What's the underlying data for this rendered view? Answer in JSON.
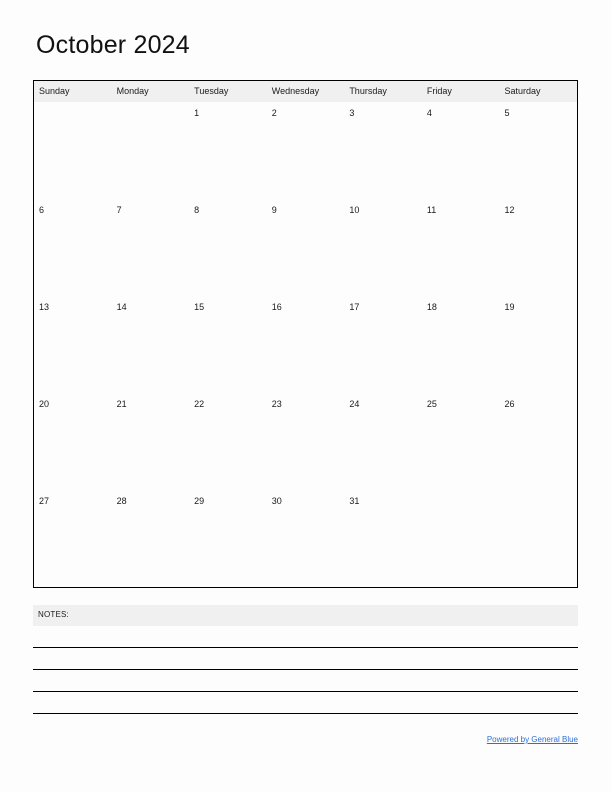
{
  "document": {
    "title": "October 2024",
    "month": "October",
    "year": "2024"
  },
  "calendar": {
    "weekday_headers": [
      "Sunday",
      "Monday",
      "Tuesday",
      "Wednesday",
      "Thursday",
      "Friday",
      "Saturday"
    ],
    "weeks": [
      [
        "",
        "",
        "1",
        "2",
        "3",
        "4",
        "5"
      ],
      [
        "6",
        "7",
        "8",
        "9",
        "10",
        "11",
        "12"
      ],
      [
        "13",
        "14",
        "15",
        "16",
        "17",
        "18",
        "19"
      ],
      [
        "20",
        "21",
        "22",
        "23",
        "24",
        "25",
        "26"
      ],
      [
        "27",
        "28",
        "29",
        "30",
        "31",
        "",
        ""
      ]
    ]
  },
  "notes": {
    "label": "NOTES:",
    "line_count": 4
  },
  "footer": {
    "link_text": "Powered by General Blue"
  },
  "colors": {
    "header_band": "#f0f0f0",
    "grid_border": "#000000",
    "link": "#2a6fdb",
    "text": "#1a1a1a",
    "page_background": "#fdfdfd"
  }
}
